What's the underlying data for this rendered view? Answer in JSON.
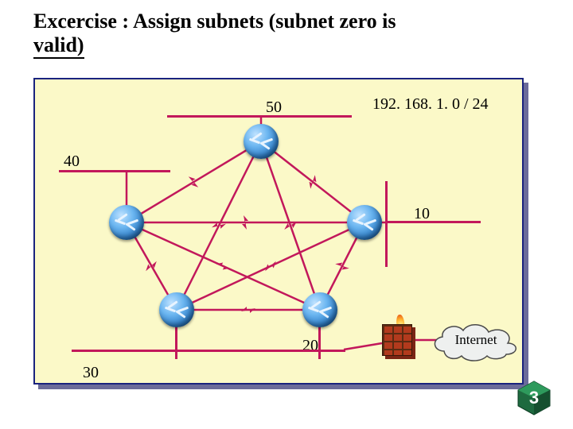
{
  "title_line1": "Excercise : Assign subnets (subnet zero is",
  "title_line2": "valid)",
  "network_cidr": "192. 168. 1. 0 / 24",
  "segments": {
    "top": "50",
    "left": "40",
    "right": "10",
    "bottom_right": "20",
    "bottom_left": "30"
  },
  "cloud_label": "Internet",
  "slide_number": "3",
  "icons": {
    "router": "router-icon",
    "firewall": "firewall-icon",
    "cloud": "cloud-icon"
  },
  "routers": [
    "R-top",
    "R-left",
    "R-right",
    "R-bottom-left",
    "R-bottom-right"
  ]
}
